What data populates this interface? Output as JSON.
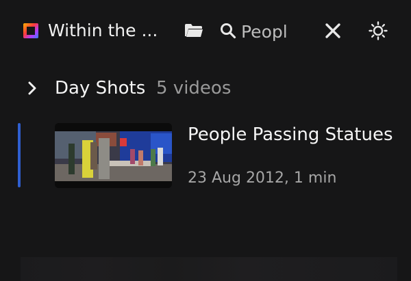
{
  "header": {
    "app_logo": "app-logo-icon",
    "title": "Within the ...",
    "search_placeholder": "Peopl",
    "search_value": "Peopl",
    "icons": [
      "folder-icon",
      "search-icon",
      "close-icon",
      "sun-icon"
    ]
  },
  "group": {
    "title": "Day Shots",
    "count": "5 videos",
    "icon": "chevron-right-icon"
  },
  "items": [
    {
      "title": "People Passing Statues",
      "meta": "23 Aug 2012, 1 min",
      "selected_color": "#2f5fd0"
    }
  ],
  "colors": {
    "background": "#161617",
    "text": "#f2f2f2",
    "muted": "#9a9a9a",
    "accent": "#2f5fd0"
  }
}
